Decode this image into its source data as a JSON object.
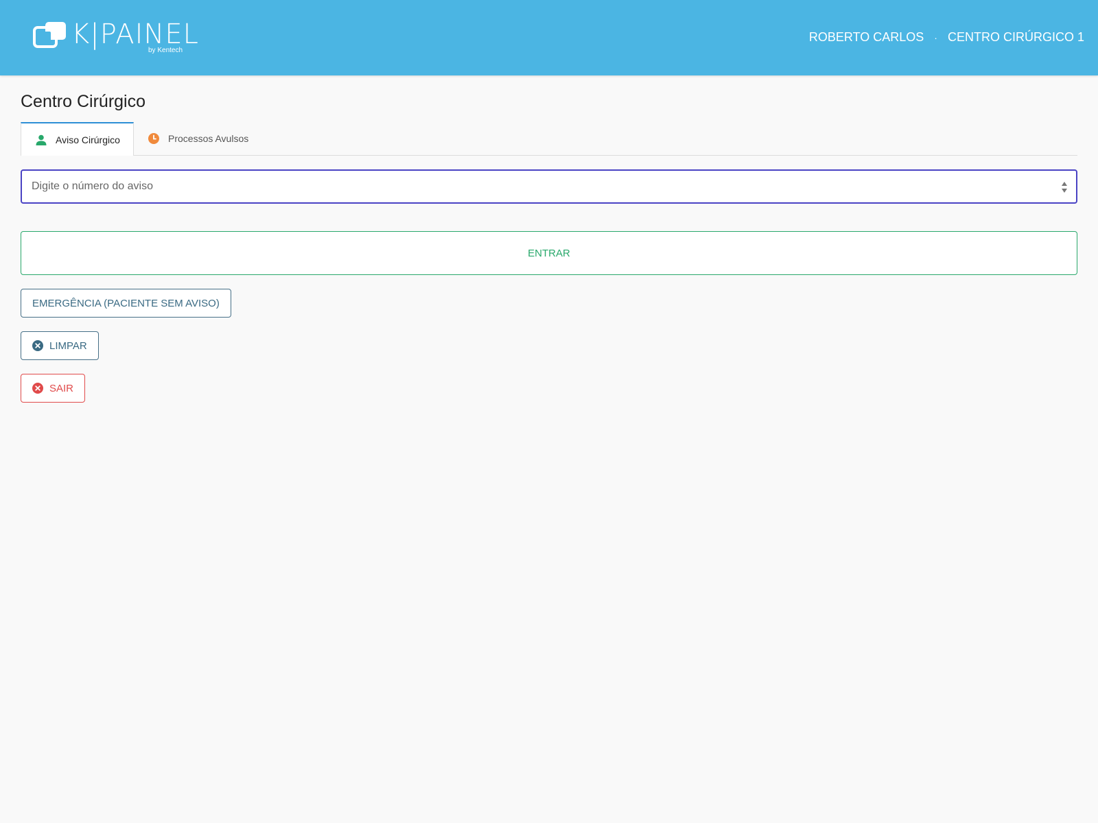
{
  "header": {
    "logo_text": "K|PAINEL",
    "logo_sub": "by Kentech",
    "user_name": "ROBERTO CARLOS",
    "separator": "·",
    "unit_name": "CENTRO CIRÚRGICO 1",
    "bg_color": "#4bb5e3"
  },
  "page": {
    "title": "Centro Cirúrgico"
  },
  "tabs": [
    {
      "label": "Aviso Cirúrgico",
      "icon": "user-icon",
      "icon_color": "#28a86b",
      "active": true
    },
    {
      "label": "Processos Avulsos",
      "icon": "clock-icon",
      "icon_color": "#f08a3c",
      "active": false
    }
  ],
  "search": {
    "placeholder": "Digite o número do aviso",
    "value": ""
  },
  "buttons": {
    "entrar": "ENTRAR",
    "emergencia": "EMERGÊNCIA (PACIENTE SEM AVISO)",
    "limpar": "LIMPAR",
    "sair": "SAIR"
  },
  "colors": {
    "accent_focus": "#4a43c4",
    "success": "#28a86b",
    "secondary": "#466f87",
    "danger": "#e04a4a",
    "tab_active_border": "#2d8ed6"
  }
}
